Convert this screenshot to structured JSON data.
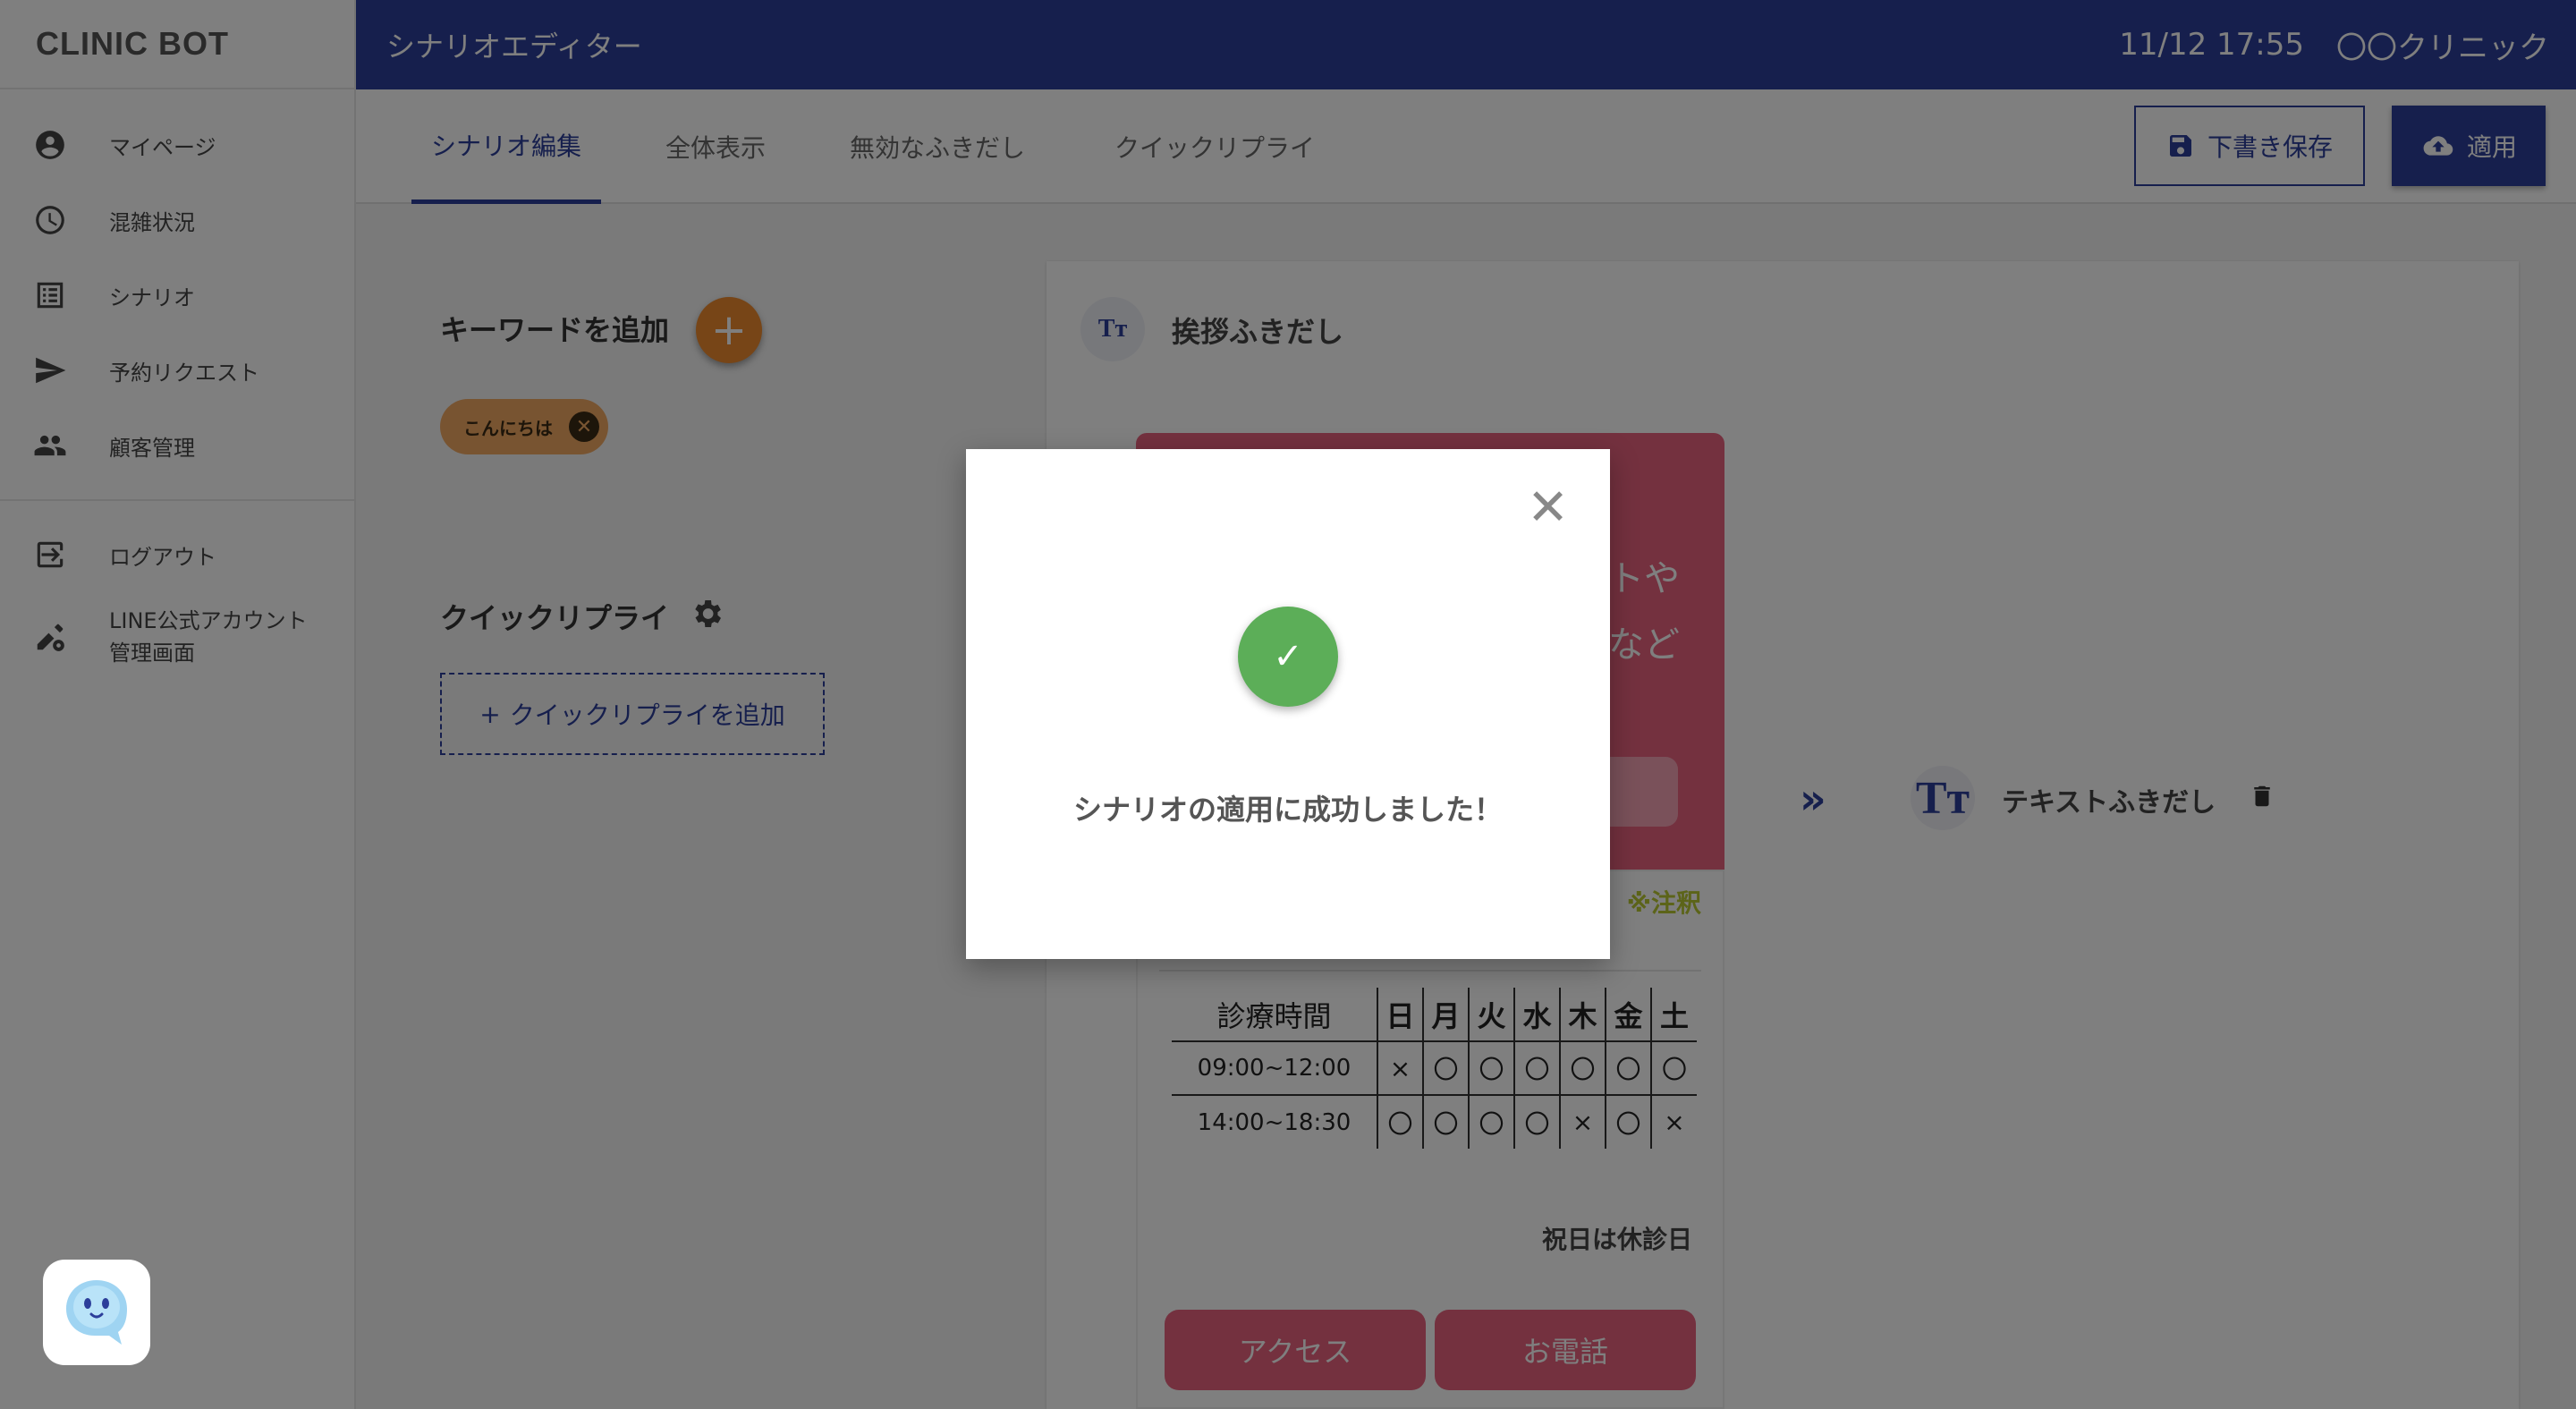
{
  "app": {
    "brand": "CLINIC BOT",
    "title": "シナリオエディター",
    "datetime": "11/12 17:55",
    "clinic": "〇〇クリニック"
  },
  "sidebar": {
    "items": [
      {
        "label": "マイページ",
        "icon": "account-circle-icon"
      },
      {
        "label": "混雑状況",
        "icon": "clock-icon"
      },
      {
        "label": "シナリオ",
        "icon": "list-icon"
      },
      {
        "label": "予約リクエスト",
        "icon": "send-icon"
      },
      {
        "label": "顧客管理",
        "icon": "people-icon"
      }
    ],
    "bottom_items": [
      {
        "label": "ログアウト",
        "icon": "logout-icon"
      },
      {
        "label_line1": "LINE公式アカウント",
        "label_line2": "管理画面",
        "icon": "edit-settings-icon"
      }
    ]
  },
  "tabs": [
    "シナリオ編集",
    "全体表示",
    "無効なふきだし",
    "クイックリプライ"
  ],
  "actions": {
    "draft": "下書き保存",
    "apply": "適用"
  },
  "keywords": {
    "title": "キーワードを追加",
    "chips": [
      "こんにちは"
    ]
  },
  "quick_reply": {
    "title": "クイックリプライ",
    "add_label": "クイックリプライを追加"
  },
  "greeting": {
    "icon_text": "Tт",
    "title": "挨拶ふきだし",
    "preview_line1": "トや",
    "preview_line2": "など",
    "note": "※注釈",
    "hours": "09:00~12:00,14:00~18:30",
    "schedule": {
      "header": "診療時間",
      "days": [
        "日",
        "月",
        "火",
        "水",
        "木",
        "金",
        "土"
      ],
      "rows": [
        {
          "time": "09:00~12:00",
          "marks": [
            "×",
            "〇",
            "〇",
            "〇",
            "〇",
            "〇",
            "〇"
          ]
        },
        {
          "time": "14:00~18:30",
          "marks": [
            "〇",
            "〇",
            "〇",
            "〇",
            "×",
            "〇",
            "×"
          ]
        }
      ]
    },
    "holiday": "祝日は休診日",
    "buttons": [
      "アクセス",
      "お電話"
    ]
  },
  "next": {
    "icon_text": "Tт",
    "title": "テキストふきだし"
  },
  "modal": {
    "message": "シナリオの適用に成功しました！"
  },
  "colors": {
    "primary": "#2c3e9a",
    "accent": "#ee8a2e",
    "success": "#5cae58",
    "bubble": "#e8627f"
  }
}
